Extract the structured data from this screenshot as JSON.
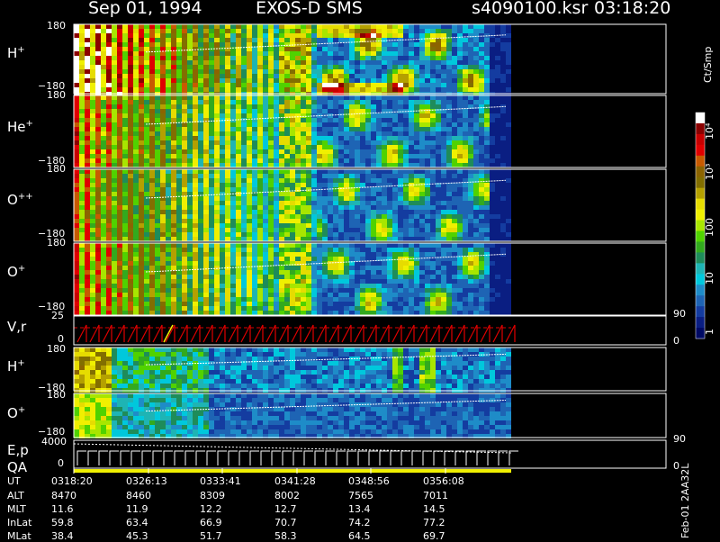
{
  "header": {
    "date": "Sep 01, 1994",
    "instrument": "EXOS-D SMS",
    "file": "s4090100.ksr",
    "time": "03:18:20"
  },
  "colorbar": {
    "unit": "Ct/Smp",
    "ticks": [
      "10⁴",
      "10³",
      "100",
      "10",
      "1"
    ],
    "colors": [
      "#ffffff",
      "#8b0000",
      "#c80000",
      "#e00000",
      "#c85a00",
      "#8c6400",
      "#826e00",
      "#b4a000",
      "#e6dc00",
      "#f0f000",
      "#a8e600",
      "#50d200",
      "#32aa1e",
      "#1e8c5a",
      "#1eb4b4",
      "#00c8dc",
      "#1e8cc8",
      "#1e64b4",
      "#143ca0",
      "#0a1e82",
      "#000a64"
    ]
  },
  "panels": {
    "h_plus": {
      "name": "H",
      "sup": "+",
      "top": "180",
      "bottom": "−180"
    },
    "he_plus": {
      "name": "He",
      "sup": "+",
      "top": "180",
      "bottom": "−180"
    },
    "o_pp": {
      "name": "O",
      "sup": "++",
      "top": "180",
      "bottom": "−180"
    },
    "o_plus": {
      "name": "O",
      "sup": "+",
      "top": "180",
      "bottom": "−180"
    },
    "vr": {
      "name": "V,r",
      "top": "25",
      "zero": "0",
      "right_top": "90",
      "right_zero": "0"
    },
    "h_plus2": {
      "name": "H",
      "sup": "+",
      "top": "180",
      "bottom": "−180"
    },
    "o_plus2": {
      "name": "O",
      "sup": "+",
      "top": "180",
      "bottom": "−180"
    },
    "ep": {
      "name": "E,p",
      "name2": "QA",
      "top": "4000",
      "zero": "0",
      "right_top": "90",
      "right_zero": "0"
    }
  },
  "ephemeris": {
    "labels": [
      "UT",
      "ALT",
      "MLT",
      "InLat",
      "MLat"
    ],
    "columns": [
      [
        "0318:20",
        "8470",
        "11.6",
        "59.8",
        "38.4"
      ],
      [
        "0326:13",
        "8460",
        "11.9",
        "63.4",
        "45.3"
      ],
      [
        "0333:41",
        "8309",
        "12.2",
        "66.9",
        "51.7"
      ],
      [
        "0341:28",
        "8002",
        "12.7",
        "70.7",
        "58.3"
      ],
      [
        "0348:56",
        "7565",
        "13.4",
        "74.2",
        "64.5"
      ],
      [
        "0356:08",
        "7011",
        "14.5",
        "77.2",
        "69.7"
      ]
    ]
  },
  "footer_note": "Feb-01 2AA32L"
}
